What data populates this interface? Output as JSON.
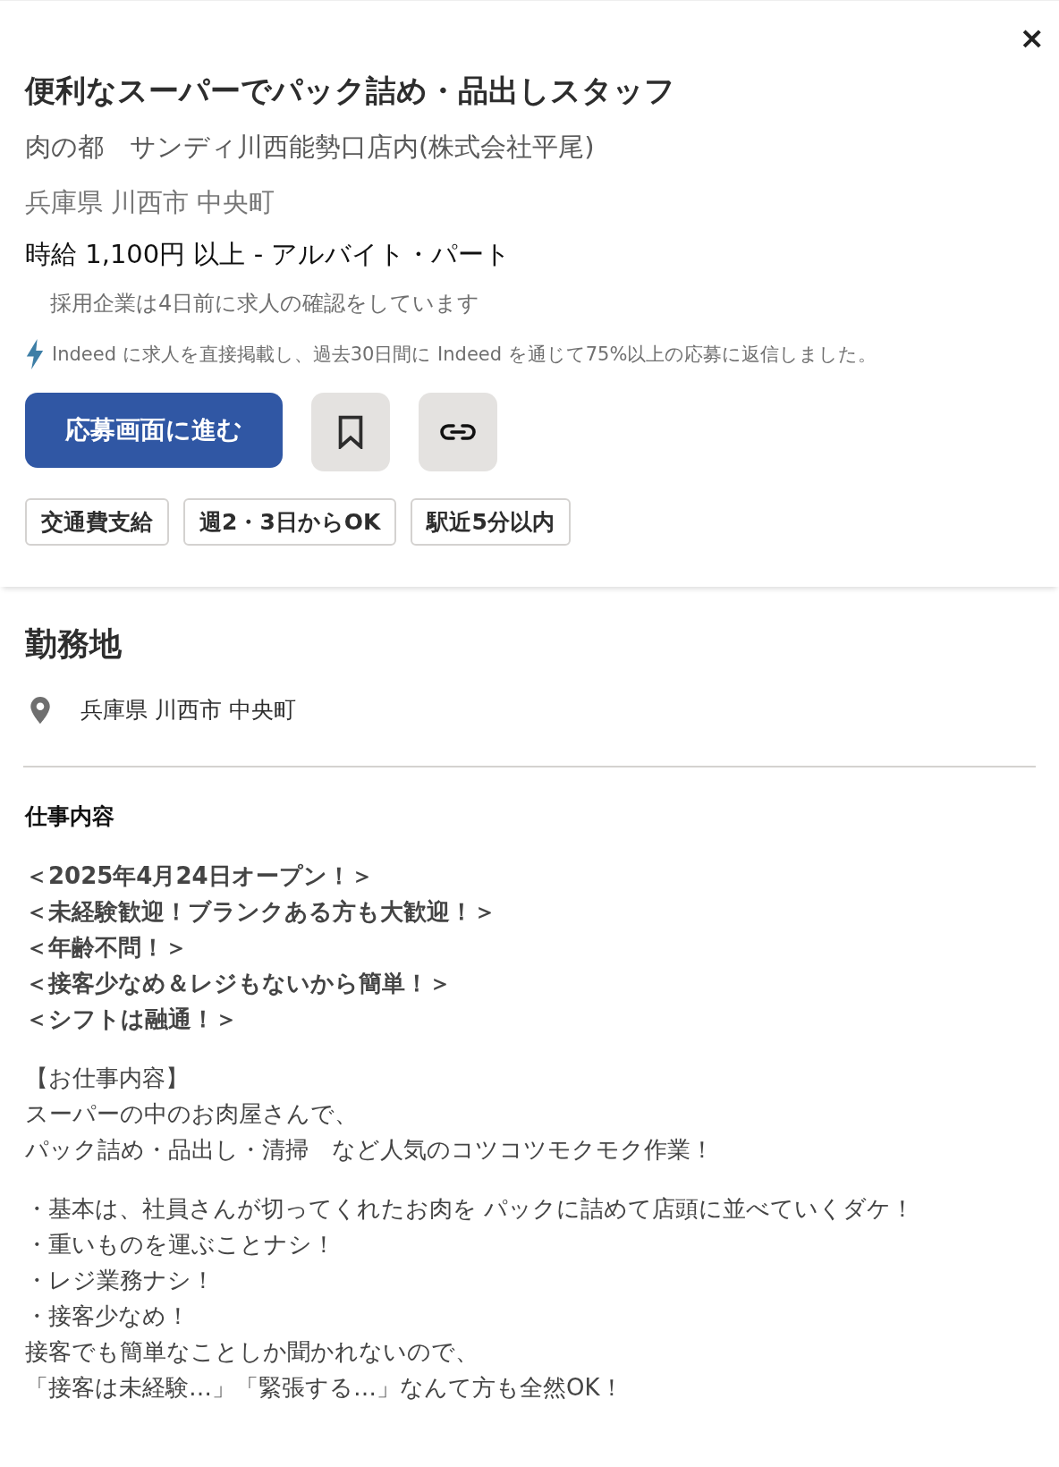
{
  "close_label": "×",
  "job": {
    "title": "便利なスーパーでパック詰め・品出しスタッフ",
    "company": "肉の都　サンディ川西能勢口店内(株式会社平尾)",
    "location": "兵庫県 川西市 中央町",
    "salary": "時給 1,100円 以上  - アルバイト・パート",
    "confirmed": "採用企業は4日前に求人の確認をしています",
    "responsive_note": "Indeed に求人を直接掲載し、過去30日間に Indeed を通じて75%以上の応募に返信しました。"
  },
  "actions": {
    "apply": "応募画面に進む",
    "saved": false
  },
  "tags": [
    "交通費支給",
    "週2・3日からOK",
    "駅近5分以内"
  ],
  "workplace": {
    "heading": "勤務地",
    "address": "兵庫県 川西市 中央町"
  },
  "description": {
    "heading": "仕事内容",
    "blocks": [
      {
        "kind": "bold",
        "lines": [
          "＜2025年4月24日オープン！＞",
          "＜未経験歓迎！ブランクある方も大歓迎！＞",
          "＜年齢不問！＞",
          "＜接客少なめ＆レジもないから簡単！＞",
          "＜シフトは融通！＞"
        ]
      },
      {
        "kind": "plain",
        "lines": [
          "【お仕事内容】",
          "スーパーの中のお肉屋さんで、",
          "パック詰め・品出し・清掃　など人気のコツコツモクモク作業！"
        ]
      },
      {
        "kind": "plain",
        "lines": [
          "・基本は、社員さんが切ってくれたお肉を パックに詰めて店頭に並べていくダケ！",
          "・重いものを運ぶことナシ！",
          "・レジ業務ナシ！",
          "・接客少なめ！",
          "接客でも簡単なことしか聞かれないので、",
          "「接客は未経験…」「緊張する…」なんて方も全然OK！"
        ]
      }
    ]
  }
}
